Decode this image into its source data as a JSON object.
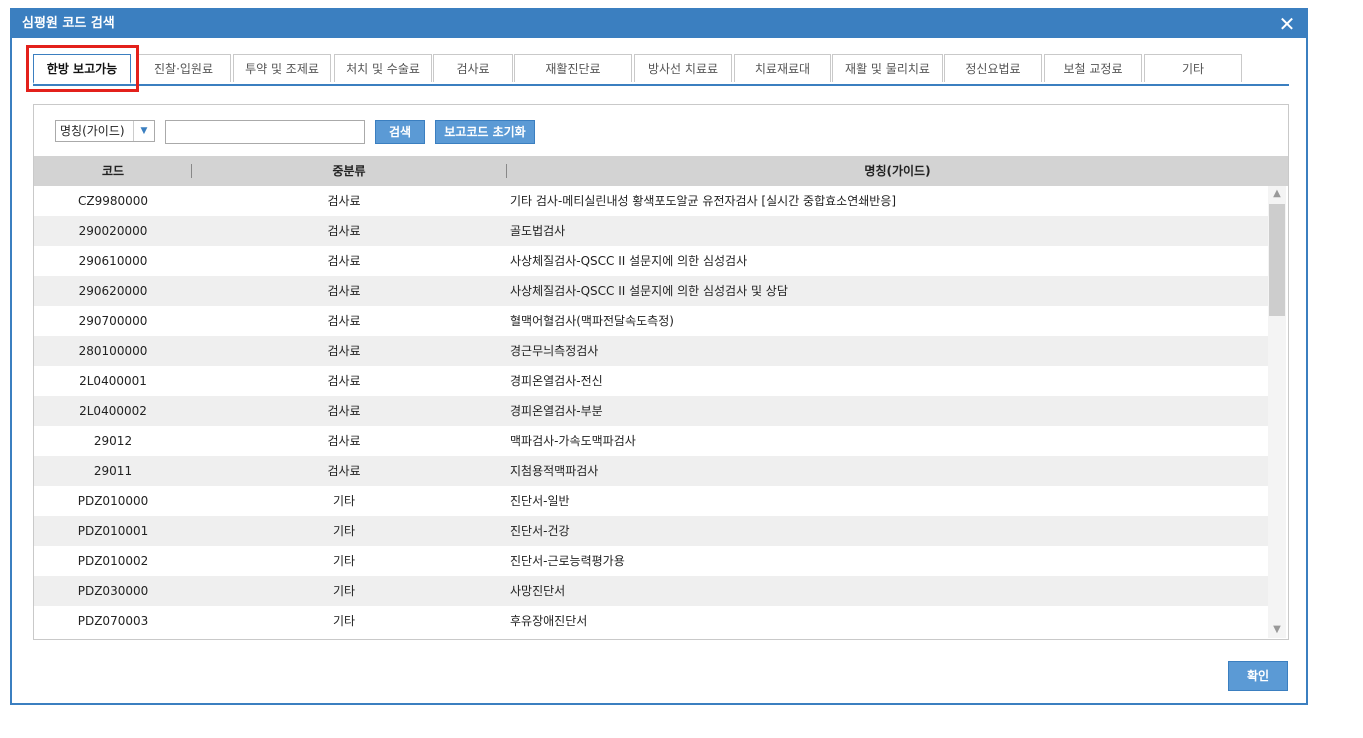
{
  "dialog": {
    "title": "심평원 코드 검색",
    "close_icon": "close-icon"
  },
  "tabs": [
    {
      "label": "한방 보고가능",
      "active": true
    },
    {
      "label": "진찰·입원료"
    },
    {
      "label": "투약 및 조제료"
    },
    {
      "label": "처치 및 수술료"
    },
    {
      "label": "검사료"
    },
    {
      "label": "재활진단료"
    },
    {
      "label": "방사선 치료료"
    },
    {
      "label": "치료재료대"
    },
    {
      "label": "재활 및 물리치료"
    },
    {
      "label": "정신요법료"
    },
    {
      "label": "보철 교정료"
    },
    {
      "label": "기타"
    }
  ],
  "search": {
    "field_select": "명칭(가이드)",
    "input_value": "",
    "search_button": "검색",
    "reset_button": "보고코드 초기화"
  },
  "grid": {
    "columns": [
      "코드",
      "중분류",
      "명칭(가이드)"
    ],
    "rows": [
      [
        "CZ9980000",
        "검사료",
        "기타 검사-메티실린내성 황색포도알균 유전자검사 [실시간 중합효소연쇄반응]"
      ],
      [
        "290020000",
        "검사료",
        "골도법검사"
      ],
      [
        "290610000",
        "검사료",
        "사상체질검사-QSCC II 설문지에 의한 심성검사"
      ],
      [
        "290620000",
        "검사료",
        "사상체질검사-QSCC II 설문지에 의한 심성검사 및 상담"
      ],
      [
        "290700000",
        "검사료",
        "혈맥어혈검사(맥파전달속도측정)"
      ],
      [
        "280100000",
        "검사료",
        "경근무늬측정검사"
      ],
      [
        "2L0400001",
        "검사료",
        "경피온열검사-전신"
      ],
      [
        "2L0400002",
        "검사료",
        "경피온열검사-부분"
      ],
      [
        "29012",
        "검사료",
        "맥파검사-가속도맥파검사"
      ],
      [
        "29011",
        "검사료",
        "지첨용적맥파검사"
      ],
      [
        "PDZ010000",
        "기타",
        "진단서-일반"
      ],
      [
        "PDZ010001",
        "기타",
        "진단서-건강"
      ],
      [
        "PDZ010002",
        "기타",
        "진단서-근로능력평가용"
      ],
      [
        "PDZ030000",
        "기타",
        "사망진단서"
      ],
      [
        "PDZ070003",
        "기타",
        "후유장애진단서"
      ]
    ]
  },
  "footer": {
    "ok_button": "확인"
  },
  "colors": {
    "accent": "#3b7fc0",
    "button": "#5b9ad5",
    "highlight": "#e3201b",
    "header_bg": "#d3d3d3",
    "row_alt": "#efefef"
  }
}
